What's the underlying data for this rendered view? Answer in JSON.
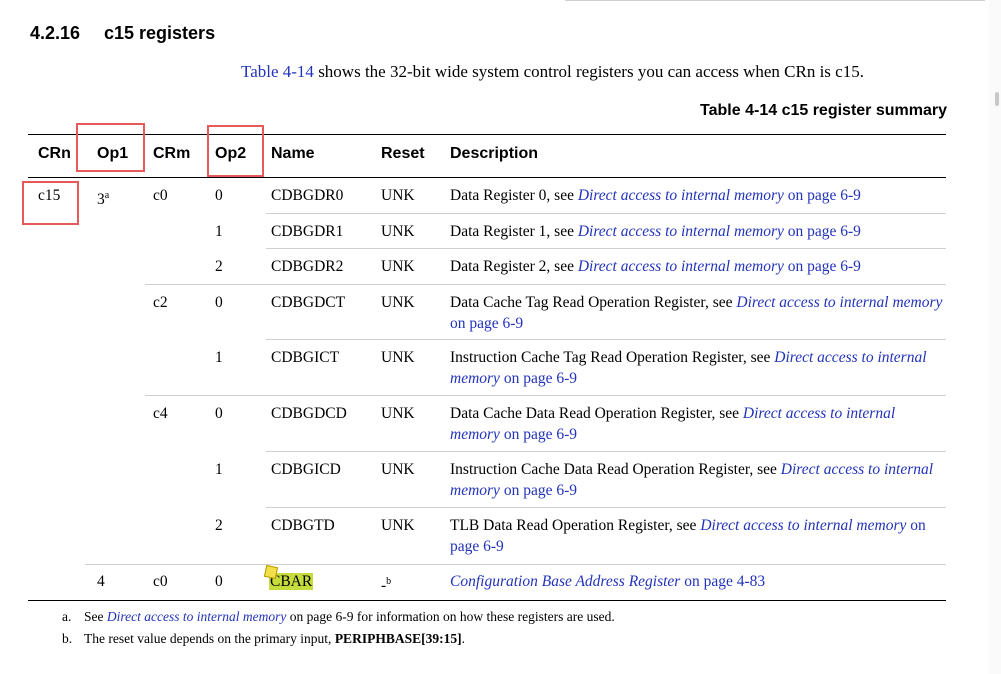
{
  "heading": {
    "number": "4.2.16",
    "title": "c15 registers"
  },
  "intro": {
    "link": "Table 4-14",
    "text": " shows the 32-bit wide system control registers you can access when CRn is c15."
  },
  "table_title": "Table 4-14 c15 register summary",
  "columns": [
    "CRn",
    "Op1",
    "CRm",
    "Op2",
    "Name",
    "Reset",
    "Description"
  ],
  "rows": [
    {
      "crn": "c15",
      "op1": "3",
      "op1_sup": "a",
      "crm": "c0",
      "op2": "0",
      "name": "CDBGDR0",
      "reset": "UNK",
      "desc_pre": "Data Register 0, see ",
      "desc_link": "Direct access to internal memory",
      "desc_post": " on page 6-9"
    },
    {
      "crn": "",
      "op1": "",
      "op1_sup": "",
      "crm": "",
      "op2": "1",
      "name": "CDBGDR1",
      "reset": "UNK",
      "desc_pre": "Data Register 1, see ",
      "desc_link": "Direct access to internal memory",
      "desc_post": " on page 6-9"
    },
    {
      "crn": "",
      "op1": "",
      "op1_sup": "",
      "crm": "",
      "op2": "2",
      "name": "CDBGDR2",
      "reset": "UNK",
      "desc_pre": "Data Register 2, see ",
      "desc_link": "Direct access to internal memory",
      "desc_post": " on page 6-9"
    },
    {
      "crn": "",
      "op1": "",
      "op1_sup": "",
      "crm": "c2",
      "op2": "0",
      "name": "CDBGDCT",
      "reset": "UNK",
      "desc_pre": "Data Cache Tag Read Operation Register, see ",
      "desc_link": "Direct access to internal memory",
      "desc_post": " on page 6-9"
    },
    {
      "crn": "",
      "op1": "",
      "op1_sup": "",
      "crm": "",
      "op2": "1",
      "name": "CDBGICT",
      "reset": "UNK",
      "desc_pre": "Instruction Cache Tag Read Operation Register, see ",
      "desc_link": "Direct access to internal memory",
      "desc_post": " on page 6-9"
    },
    {
      "crn": "",
      "op1": "",
      "op1_sup": "",
      "crm": "c4",
      "op2": "0",
      "name": "CDBGDCD",
      "reset": "UNK",
      "desc_pre": "Data Cache Data Read Operation Register, see ",
      "desc_link": "Direct access to internal memory",
      "desc_post": " on page 6-9"
    },
    {
      "crn": "",
      "op1": "",
      "op1_sup": "",
      "crm": "",
      "op2": "1",
      "name": "CDBGICD",
      "reset": "UNK",
      "desc_pre": "Instruction Cache Data Read Operation Register, see ",
      "desc_link": "Direct access to internal memory",
      "desc_post": " on page 6-9"
    },
    {
      "crn": "",
      "op1": "",
      "op1_sup": "",
      "crm": "",
      "op2": "2",
      "name": "CDBGTD",
      "reset": "UNK",
      "desc_pre": "TLB Data Read Operation Register, see ",
      "desc_link": "Direct access to internal memory",
      "desc_post": " on page 6-9"
    },
    {
      "crn": "",
      "op1": "4",
      "op1_sup": "",
      "crm": "c0",
      "op2": "0",
      "name": "CBAR",
      "reset": "-",
      "reset_sup": "b",
      "desc_pre": "",
      "desc_link": "Configuration Base Address Register",
      "desc_post": " on page 4-83"
    }
  ],
  "footnotes": [
    {
      "label": "a.",
      "pre": "See ",
      "link": "Direct access to internal memory",
      "post": " on page 6-9 for information on how these registers are used."
    },
    {
      "label": "b.",
      "pre": "The reset value depends on the primary input, ",
      "bold": "PERIPHBASE[39:15]",
      "post": "."
    }
  ],
  "colors": {
    "link": "#2233bb",
    "annotation_box": "#e85a5a",
    "highlight": "#c6dc3c"
  }
}
